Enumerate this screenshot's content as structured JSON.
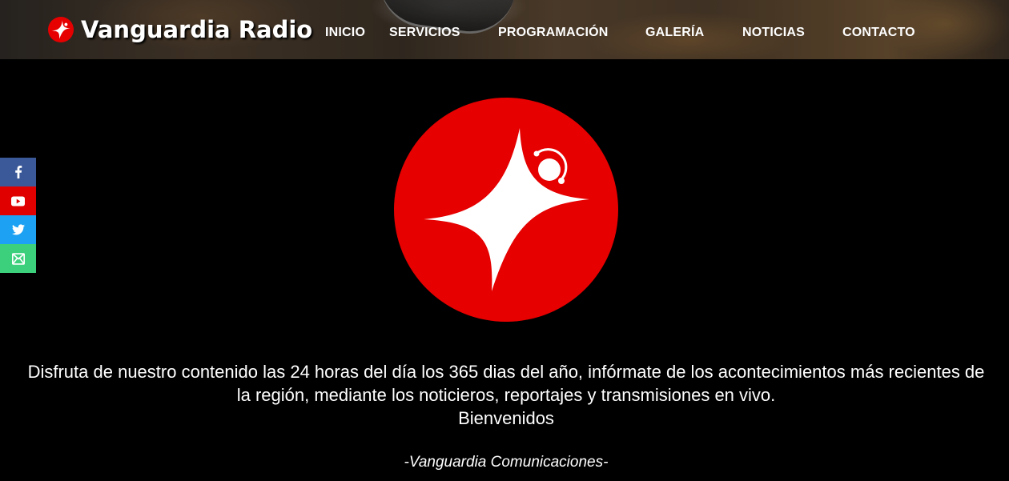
{
  "header": {
    "brand_name": "Vanguardia Radio",
    "logo_icon": "red-star-sparkle-icon"
  },
  "nav": {
    "items": [
      {
        "label": "INICIO"
      },
      {
        "label": "SERVICIOS"
      },
      {
        "label": "PROGRAMACIÓN"
      },
      {
        "label": "GALERÍA"
      },
      {
        "label": "NOTICIAS"
      },
      {
        "label": "CONTACTO"
      }
    ]
  },
  "social": [
    {
      "icon": "facebook-icon",
      "color": "#3b5998"
    },
    {
      "icon": "youtube-icon",
      "color": "#e00000"
    },
    {
      "icon": "twitter-icon",
      "color": "#1da1f2"
    },
    {
      "icon": "email-icon",
      "color": "#3cd07c"
    }
  ],
  "hero": {
    "logo_icon": "vanguardia-logo-icon",
    "brand_color": "#e60000",
    "description_line1": "Disfruta de nuestro contenido las 24 horas del día los 365 dias del año, infórmate de los acontecimientos más recientes de la región, mediante los noticieros, reportajes y transmisiones en vivo.",
    "welcome": "Bienvenidos",
    "signature": "-Vanguardia Comunicaciones-"
  }
}
